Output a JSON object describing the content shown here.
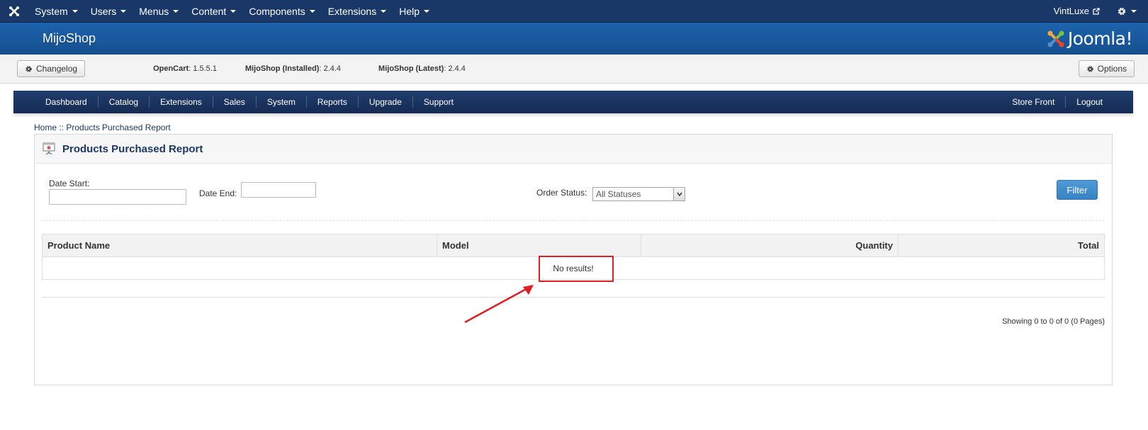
{
  "topbar": {
    "menu": [
      "System",
      "Users",
      "Menus",
      "Content",
      "Components",
      "Extensions",
      "Help"
    ],
    "user": "VintLuxe"
  },
  "header": {
    "title": "MijoShop",
    "brand": "Joomla!"
  },
  "subbar": {
    "changelog_label": "Changelog",
    "opencart_label": "OpenCart",
    "opencart_version": "1.5.5.1",
    "installed_label": "MijoShop (Installed)",
    "installed_version": "2.4.4",
    "latest_label": "MijoShop (Latest)",
    "latest_version": "2.4.4",
    "options_label": "Options"
  },
  "navbar": {
    "left": [
      "Dashboard",
      "Catalog",
      "Extensions",
      "Sales",
      "System",
      "Reports",
      "Upgrade",
      "Support"
    ],
    "right": [
      "Store Front",
      "Logout"
    ]
  },
  "breadcrumb": {
    "home": "Home",
    "separator": " :: ",
    "current": "Products Purchased Report"
  },
  "report": {
    "title": "Products Purchased Report",
    "date_start_label": "Date Start:",
    "date_start_value": "",
    "date_end_label": "Date End:",
    "date_end_value": "",
    "order_status_label": "Order Status:",
    "order_status_value": "All Statuses",
    "filter_label": "Filter",
    "columns": [
      "Product Name",
      "Model",
      "Quantity",
      "Total"
    ],
    "empty_message": "No results!",
    "pagination": "Showing 0 to 0 of 0 (0 Pages)"
  },
  "colors": {
    "topbar": "#1a3867",
    "header": "#17569b",
    "navbar": "#1b3563",
    "filter_button": "#4289ca",
    "annotation": "#e02020"
  }
}
